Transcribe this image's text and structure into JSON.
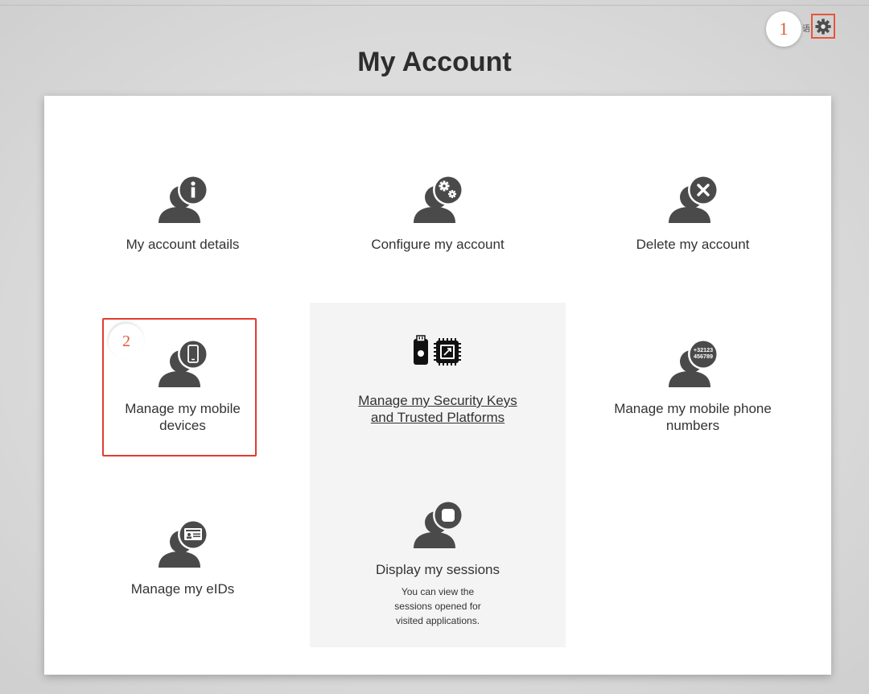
{
  "header": {
    "title": "My Account",
    "lang_glyph": "语",
    "settings_icon": "gear-icon"
  },
  "callouts": [
    "1",
    "2"
  ],
  "tiles": [
    {
      "label": "My account details",
      "icon": "user-info-icon",
      "link": false
    },
    {
      "label": "Configure my account",
      "icon": "user-gears-icon",
      "link": false
    },
    {
      "label": "Delete my account",
      "icon": "user-delete-icon",
      "link": false
    },
    {
      "label": "Manage my mobile devices",
      "icon": "user-mobile-icon",
      "link": false
    },
    {
      "label": "Manage my Security Keys and Trusted Platforms",
      "icon": "security-key-chip-icon",
      "link": true
    },
    {
      "label": "Manage my mobile phone numbers",
      "icon": "user-phone-numbers-icon",
      "link": false,
      "icon_text": [
        "+32123",
        "456789"
      ]
    },
    {
      "label": "Manage my eIDs",
      "icon": "user-eid-card-icon",
      "link": false
    },
    {
      "label": "Display my sessions",
      "icon": "user-sessions-icon",
      "link": false,
      "description": "You can view the sessions opened for visited applications."
    }
  ],
  "colors": {
    "icon_gray": "#4a4a4a",
    "highlight_red": "#e33b2e",
    "callout_orange": "#e05a3a"
  }
}
